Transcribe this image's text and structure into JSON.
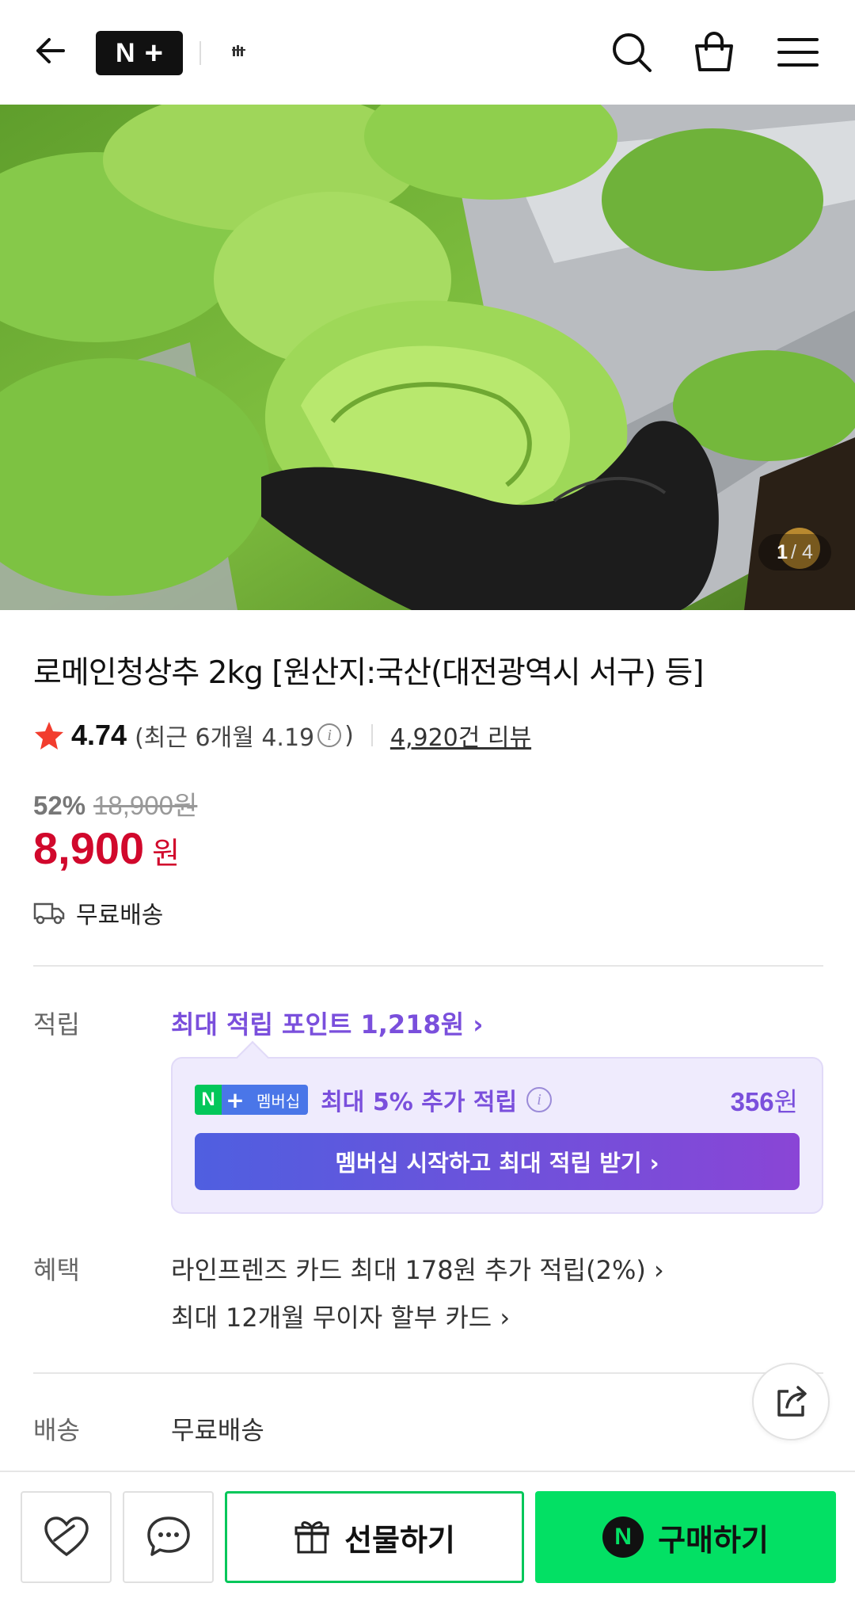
{
  "header": {
    "back_icon": "arrow-left-icon",
    "logo_n": "N",
    "logo_plus": "+",
    "search_icon": "search-icon",
    "cart_icon": "shopping-bag-icon",
    "menu_icon": "hamburger-menu-icon"
  },
  "gallery": {
    "current": "1",
    "total": "/ 4"
  },
  "product": {
    "title": "로메인청상추 2kg [원산지:국산(대전광역시 서구) 등]",
    "rating": "4.74",
    "recent_prefix": "(최근 6개월 4.19",
    "recent_suffix": ")",
    "review_link": "4,920건 리뷰",
    "discount_rate": "52%",
    "original_price": "18,900원",
    "price": "8,900",
    "price_unit": "원",
    "shipping": "무료배송"
  },
  "points": {
    "label": "적립",
    "max_point_link": "최대 적립 포인트 1,218원 ›",
    "badge_n": "N",
    "badge_plus": "+",
    "badge_text": "멤버십",
    "member_text": "최대 5% 추가 적립",
    "member_amount": "356",
    "member_amount_unit": "원",
    "member_button": "멤버십 시작하고 최대 적립 받기 ›"
  },
  "benefits": {
    "label": "혜택",
    "line1": "라인프렌즈 카드 최대 178원 추가 적립(2%) ›",
    "line2": "최대 12개월 무이자 할부 카드 ›"
  },
  "delivery": {
    "label": "배송",
    "value": "무료배송"
  },
  "bottom_bar": {
    "gift_label": "선물하기",
    "buy_label": "구매하기",
    "buy_badge": "N"
  },
  "colors": {
    "price_red": "#d1082c",
    "point_purple": "#7a4fdc",
    "naver_green": "#03c75a",
    "buy_green": "#03e064"
  }
}
